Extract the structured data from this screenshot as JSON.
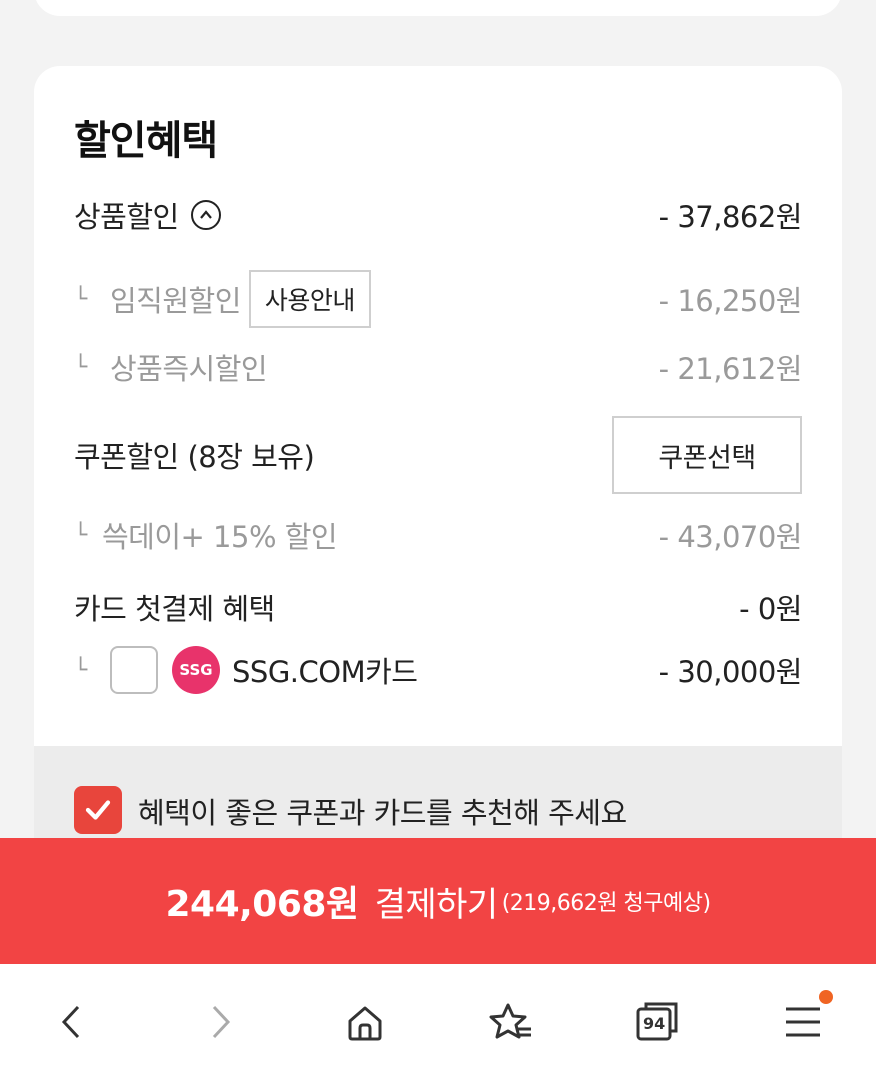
{
  "benefits": {
    "title": "할인혜택",
    "product_discount": {
      "label": "상품할인",
      "amount": "- 37,862원"
    },
    "employee_discount": {
      "label": "임직원할인",
      "info_button": "사용안내",
      "amount": "- 16,250원"
    },
    "instant_discount": {
      "label": "상품즉시할인",
      "amount": "- 21,612원"
    },
    "coupon_discount": {
      "label": "쿠폰할인 (8장 보유)",
      "button": "쿠폰선택"
    },
    "ssgday_discount": {
      "label": "쓱데이+ 15% 할인",
      "amount": "- 43,070원"
    },
    "card_first_payment": {
      "label": "카드 첫결제 혜택",
      "amount": "- 0원"
    },
    "ssg_card": {
      "logo": "SSG",
      "label": "SSG.COM카드",
      "amount": "- 30,000원",
      "checked": false
    },
    "corner_mark": "└"
  },
  "recommend": {
    "label": "혜택이 좋은 쿠폰과 카드를 추천해 주세요",
    "checked": true
  },
  "pay_bar": {
    "total": "244,068원",
    "action": "결제하기",
    "expected": "(219,662원 청구예상)"
  },
  "nav": {
    "tab_count": "94",
    "icons": [
      "back-icon",
      "forward-icon",
      "home-icon",
      "bookmark-star-icon",
      "tabs-icon",
      "menu-icon"
    ]
  },
  "colors": {
    "accent": "#f24444",
    "ssg": "#e8336b",
    "notification": "#f06423"
  }
}
